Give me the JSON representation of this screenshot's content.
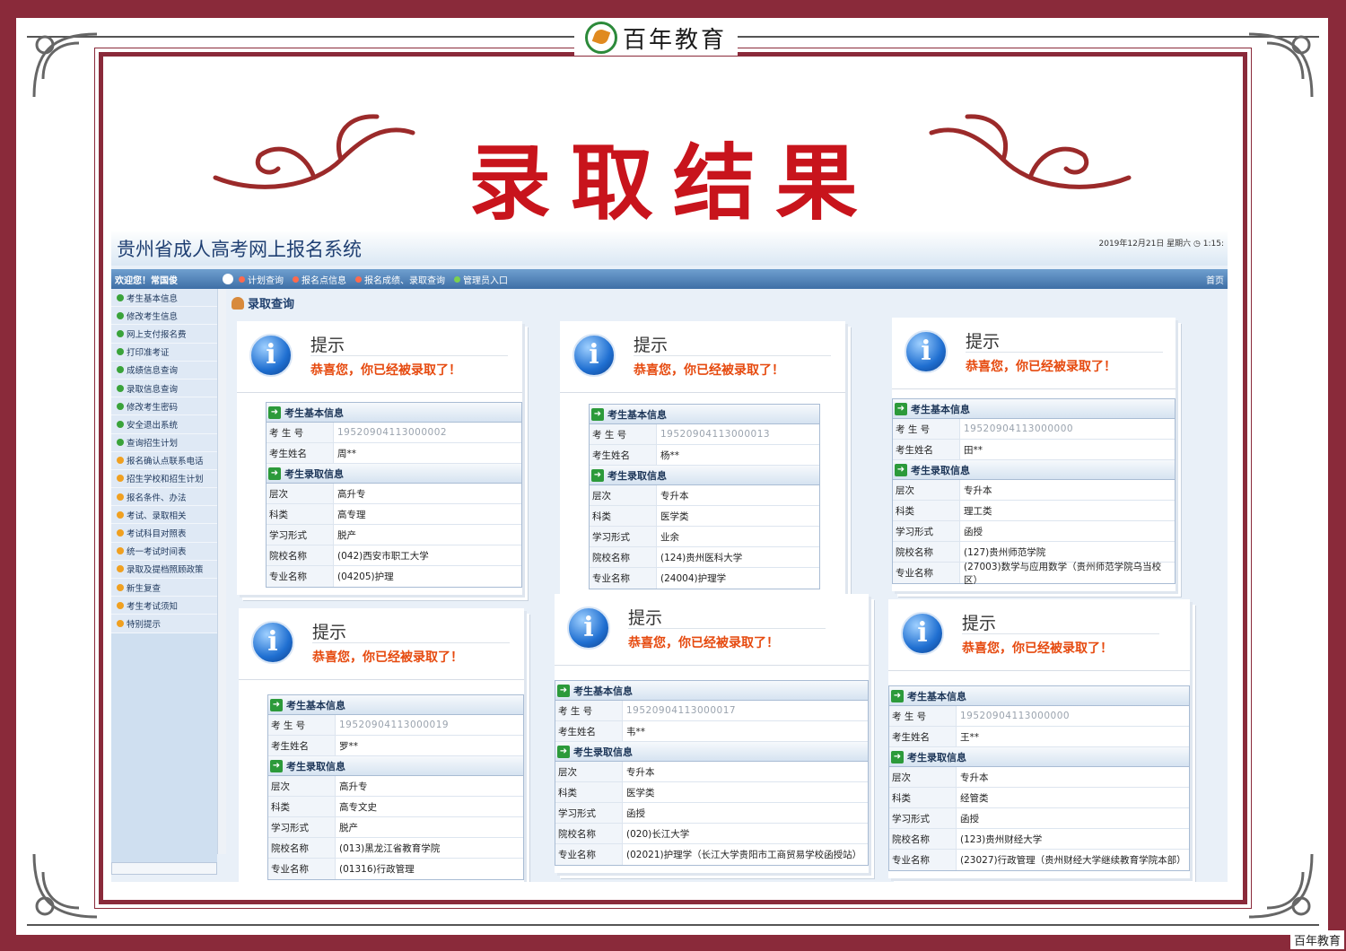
{
  "brand": {
    "logo_text": "百年教育",
    "watermark": "百年教育"
  },
  "banner": {
    "title": "录取结果"
  },
  "app": {
    "title": "贵州省成人高考网上报名系统",
    "datetime": "2019年12月21日 星期六 ◷ 1:15:",
    "welcome": "欢迎您！常国俊",
    "nav": [
      {
        "label": "计划查询",
        "color": "#ff6a4d"
      },
      {
        "label": "报名点信息",
        "color": "#ff6a4d"
      },
      {
        "label": "报名成绩、录取查询",
        "color": "#ff6a4d"
      },
      {
        "label": "管理员入口",
        "color": "#7bd04f"
      }
    ],
    "home": "首页",
    "page_heading": "录取查询",
    "sidebar": [
      {
        "label": "考生基本信息",
        "color": "#3aa33a"
      },
      {
        "label": "修改考生信息",
        "color": "#3aa33a"
      },
      {
        "label": "网上支付报名费",
        "color": "#3aa33a"
      },
      {
        "label": "打印准考证",
        "color": "#3aa33a"
      },
      {
        "label": "成绩信息查询",
        "color": "#3aa33a"
      },
      {
        "label": "录取信息查询",
        "color": "#3aa33a"
      },
      {
        "label": "修改考生密码",
        "color": "#3aa33a"
      },
      {
        "label": "安全退出系统",
        "color": "#3aa33a"
      },
      {
        "label": "查询招生计划",
        "color": "#3aa33a"
      },
      {
        "label": "报名确认点联系电话",
        "color": "#f0a020"
      },
      {
        "label": "招生学校和招生计划",
        "color": "#f0a020"
      },
      {
        "label": "报名条件、办法",
        "color": "#f0a020"
      },
      {
        "label": "考试、录取相关",
        "color": "#f0a020"
      },
      {
        "label": "考试科目对照表",
        "color": "#f0a020"
      },
      {
        "label": "统一考试时间表",
        "color": "#f0a020"
      },
      {
        "label": "录取及提档照顾政策",
        "color": "#f0a020"
      },
      {
        "label": "新生复查",
        "color": "#f0a020"
      },
      {
        "label": "考生考试须知",
        "color": "#f0a020"
      },
      {
        "label": "特别提示",
        "color": "#f0a020"
      }
    ]
  },
  "labels": {
    "tip_title": "提示",
    "tip_msg": "恭喜您，你已经被录取了！",
    "basic_section": "考生基本信息",
    "admit_section": "考生录取信息",
    "exam_no": "考 生 号",
    "name": "考生姓名",
    "level": "层次",
    "category": "科类",
    "study_mode": "学习形式",
    "school": "院校名称",
    "major": "专业名称"
  },
  "cards": [
    {
      "exam_no": "19520904113000002",
      "name": "周**",
      "level": "高升专",
      "category": "高专理",
      "study_mode": "脱产",
      "school": "(042)西安市职工大学",
      "major": "(04205)护理"
    },
    {
      "exam_no": "19520904113000013",
      "name": "杨**",
      "level": "专升本",
      "category": "医学类",
      "study_mode": "业余",
      "school": "(124)贵州医科大学",
      "major": "(24004)护理学"
    },
    {
      "exam_no": "19520904113000000",
      "name": "田**",
      "level": "专升本",
      "category": "理工类",
      "study_mode": "函授",
      "school": "(127)贵州师范学院",
      "major": "(27003)数学与应用数学（贵州师范学院乌当校区）"
    },
    {
      "exam_no": "19520904113000019",
      "name": "罗**",
      "level": "高升专",
      "category": "高专文史",
      "study_mode": "脱产",
      "school": "(013)黑龙江省教育学院",
      "major": "(01316)行政管理"
    },
    {
      "exam_no": "19520904113000017",
      "name": "韦**",
      "level": "专升本",
      "category": "医学类",
      "study_mode": "函授",
      "school": "(020)长江大学",
      "major": "(02021)护理学（长江大学贵阳市工商贸易学校函授站）"
    },
    {
      "exam_no": "19520904113000000",
      "name": "王**",
      "level": "专升本",
      "category": "经管类",
      "study_mode": "函授",
      "school": "(123)贵州财经大学",
      "major": "(23027)行政管理（贵州财经大学继续教育学院本部）"
    }
  ]
}
